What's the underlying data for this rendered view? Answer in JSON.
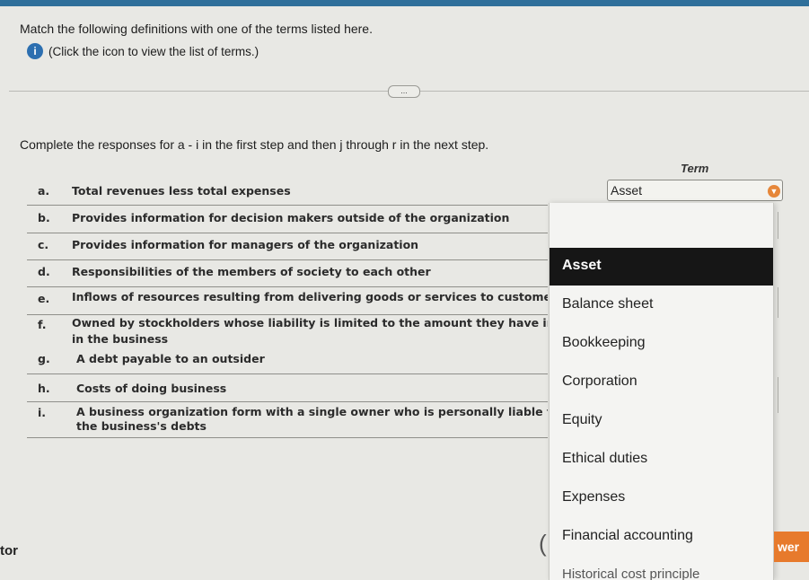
{
  "header": {
    "title": "Match the following definitions with one of the terms listed here.",
    "info_icon_glyph": "i",
    "info_text": "(Click the icon to view the list of terms.)",
    "more_button": "...",
    "accent_color": "#2f6f9a"
  },
  "question": {
    "instructions": "Complete the responses for a - i in the first step and then j through r in the next step.",
    "term_header": "Term"
  },
  "definitions": [
    {
      "letter": "a.",
      "text": "Total revenues less total expenses"
    },
    {
      "letter": "b.",
      "text": "Provides information for decision makers outside of the organization"
    },
    {
      "letter": "c.",
      "text": "Provides information for managers of the organization"
    },
    {
      "letter": "d.",
      "text": "Responsibilities of the members of society to each other"
    },
    {
      "letter": "e.",
      "text": "Inflows of resources resulting from delivering goods or services to custome"
    },
    {
      "letter": "f.",
      "text": "Owned by stockholders whose liability is limited to the amount they have in",
      "text2": "in the business"
    },
    {
      "letter": "g.",
      "text": "A debt payable to an outsider"
    },
    {
      "letter": "h.",
      "text": "Costs of doing business"
    },
    {
      "letter": "i.",
      "text": "A business organization form with a single owner who is personally liable fo",
      "text2": "the business's debts"
    }
  ],
  "answer_a": {
    "value": "Asset",
    "arrow_icon": "chevron-down-icon"
  },
  "dropdown_options": [
    {
      "label": "Asset",
      "selected": true
    },
    {
      "label": "Balance sheet",
      "selected": false
    },
    {
      "label": "Bookkeeping",
      "selected": false
    },
    {
      "label": "Corporation",
      "selected": false
    },
    {
      "label": "Equity",
      "selected": false
    },
    {
      "label": "Ethical duties",
      "selected": false
    },
    {
      "label": "Expenses",
      "selected": false
    },
    {
      "label": "Financial accounting",
      "selected": false
    },
    {
      "label": "Historical cost principle",
      "selected": false
    }
  ],
  "footer": {
    "left_text": "tor",
    "answer_button": "wer"
  }
}
